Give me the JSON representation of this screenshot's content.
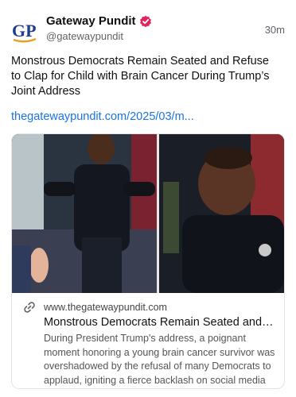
{
  "post": {
    "author": {
      "name": "Gateway Pundit",
      "handle": "@gatewaypundit",
      "avatar_text": "GP",
      "verified_icon": "verified-badge-icon",
      "verified_color": "#e0245e"
    },
    "time": "30m",
    "text": "Monstrous Democrats Remain Seated and Refuse to Clap for Child with Brain Cancer During Trump’s Joint Address",
    "link_text": "thegatewaypundit.com/2025/03/m...",
    "link_color": "#1a73e8",
    "card": {
      "domain": "www.thegatewaypundit.com",
      "title": "Monstrous Democrats Remain Seated and Ref...",
      "description": "During President Trump's address, a poignant moment honoring a young brain cancer survivor was overshadowed by the refusal of many Democrats to applaud, igniting a fierce backlash on social media an...",
      "link_icon": "link-icon"
    }
  }
}
